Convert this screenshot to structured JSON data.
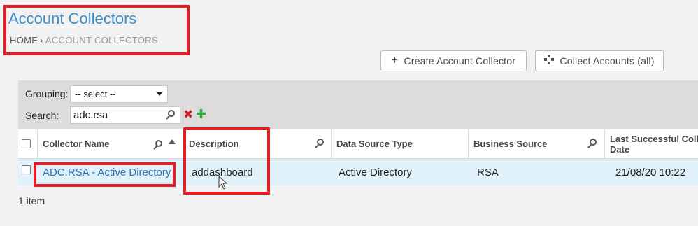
{
  "header": {
    "title": "Account Collectors",
    "breadcrumb": {
      "home": "HOME",
      "separator": "›",
      "current": "ACCOUNT COLLECTORS"
    }
  },
  "toolbar": {
    "create_label": "Create Account Collector",
    "create_icon": "plus-icon",
    "collect_label": "Collect Accounts (all)",
    "collect_icon": "collect-icon"
  },
  "filters": {
    "grouping_label": "Grouping:",
    "grouping_value": "-- select --",
    "search_label": "Search:",
    "search_value": "adc.rsa",
    "clear_icon": "✖",
    "add_icon": "✚"
  },
  "table": {
    "columns": [
      {
        "label": "Collector Name"
      },
      {
        "label": "Description"
      },
      {
        "label": "Data Source Type"
      },
      {
        "label": "Business Source"
      },
      {
        "label": "Last Successful Coll",
        "label_line2": "Date"
      }
    ],
    "rows": [
      {
        "name": "ADC.RSA - Active Directory",
        "description": "addashboard",
        "data_source_type": "Active Directory",
        "business_source": "RSA",
        "last_successful": "21/08/20 10:22"
      }
    ]
  },
  "footer": {
    "count_text": "1 item"
  },
  "colors": {
    "accent": "#3c8dc5",
    "highlight_box": "#e31e24",
    "row_selected": "#e1f1fa",
    "add_green": "#2eaa3c",
    "clear_red": "#c8202a"
  }
}
